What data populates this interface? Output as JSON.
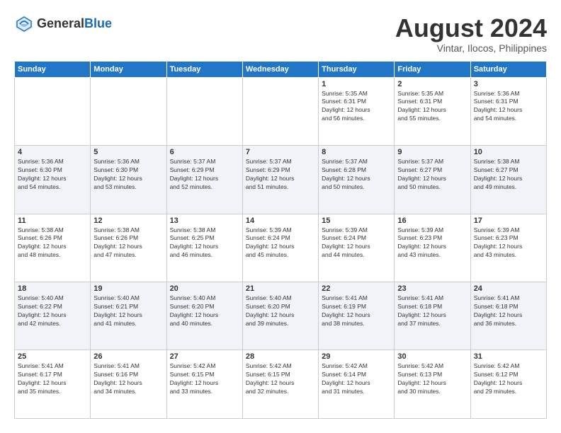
{
  "header": {
    "logo_line1": "General",
    "logo_line2": "Blue",
    "month_year": "August 2024",
    "location": "Vintar, Ilocos, Philippines"
  },
  "days_of_week": [
    "Sunday",
    "Monday",
    "Tuesday",
    "Wednesday",
    "Thursday",
    "Friday",
    "Saturday"
  ],
  "weeks": [
    [
      {
        "day": "",
        "info": ""
      },
      {
        "day": "",
        "info": ""
      },
      {
        "day": "",
        "info": ""
      },
      {
        "day": "",
        "info": ""
      },
      {
        "day": "1",
        "info": "Sunrise: 5:35 AM\nSunset: 6:31 PM\nDaylight: 12 hours\nand 56 minutes."
      },
      {
        "day": "2",
        "info": "Sunrise: 5:35 AM\nSunset: 6:31 PM\nDaylight: 12 hours\nand 55 minutes."
      },
      {
        "day": "3",
        "info": "Sunrise: 5:36 AM\nSunset: 6:31 PM\nDaylight: 12 hours\nand 54 minutes."
      }
    ],
    [
      {
        "day": "4",
        "info": "Sunrise: 5:36 AM\nSunset: 6:30 PM\nDaylight: 12 hours\nand 54 minutes."
      },
      {
        "day": "5",
        "info": "Sunrise: 5:36 AM\nSunset: 6:30 PM\nDaylight: 12 hours\nand 53 minutes."
      },
      {
        "day": "6",
        "info": "Sunrise: 5:37 AM\nSunset: 6:29 PM\nDaylight: 12 hours\nand 52 minutes."
      },
      {
        "day": "7",
        "info": "Sunrise: 5:37 AM\nSunset: 6:29 PM\nDaylight: 12 hours\nand 51 minutes."
      },
      {
        "day": "8",
        "info": "Sunrise: 5:37 AM\nSunset: 6:28 PM\nDaylight: 12 hours\nand 50 minutes."
      },
      {
        "day": "9",
        "info": "Sunrise: 5:37 AM\nSunset: 6:27 PM\nDaylight: 12 hours\nand 50 minutes."
      },
      {
        "day": "10",
        "info": "Sunrise: 5:38 AM\nSunset: 6:27 PM\nDaylight: 12 hours\nand 49 minutes."
      }
    ],
    [
      {
        "day": "11",
        "info": "Sunrise: 5:38 AM\nSunset: 6:26 PM\nDaylight: 12 hours\nand 48 minutes."
      },
      {
        "day": "12",
        "info": "Sunrise: 5:38 AM\nSunset: 6:26 PM\nDaylight: 12 hours\nand 47 minutes."
      },
      {
        "day": "13",
        "info": "Sunrise: 5:38 AM\nSunset: 6:25 PM\nDaylight: 12 hours\nand 46 minutes."
      },
      {
        "day": "14",
        "info": "Sunrise: 5:39 AM\nSunset: 6:24 PM\nDaylight: 12 hours\nand 45 minutes."
      },
      {
        "day": "15",
        "info": "Sunrise: 5:39 AM\nSunset: 6:24 PM\nDaylight: 12 hours\nand 44 minutes."
      },
      {
        "day": "16",
        "info": "Sunrise: 5:39 AM\nSunset: 6:23 PM\nDaylight: 12 hours\nand 43 minutes."
      },
      {
        "day": "17",
        "info": "Sunrise: 5:39 AM\nSunset: 6:23 PM\nDaylight: 12 hours\nand 43 minutes."
      }
    ],
    [
      {
        "day": "18",
        "info": "Sunrise: 5:40 AM\nSunset: 6:22 PM\nDaylight: 12 hours\nand 42 minutes."
      },
      {
        "day": "19",
        "info": "Sunrise: 5:40 AM\nSunset: 6:21 PM\nDaylight: 12 hours\nand 41 minutes."
      },
      {
        "day": "20",
        "info": "Sunrise: 5:40 AM\nSunset: 6:20 PM\nDaylight: 12 hours\nand 40 minutes."
      },
      {
        "day": "21",
        "info": "Sunrise: 5:40 AM\nSunset: 6:20 PM\nDaylight: 12 hours\nand 39 minutes."
      },
      {
        "day": "22",
        "info": "Sunrise: 5:41 AM\nSunset: 6:19 PM\nDaylight: 12 hours\nand 38 minutes."
      },
      {
        "day": "23",
        "info": "Sunrise: 5:41 AM\nSunset: 6:18 PM\nDaylight: 12 hours\nand 37 minutes."
      },
      {
        "day": "24",
        "info": "Sunrise: 5:41 AM\nSunset: 6:18 PM\nDaylight: 12 hours\nand 36 minutes."
      }
    ],
    [
      {
        "day": "25",
        "info": "Sunrise: 5:41 AM\nSunset: 6:17 PM\nDaylight: 12 hours\nand 35 minutes."
      },
      {
        "day": "26",
        "info": "Sunrise: 5:41 AM\nSunset: 6:16 PM\nDaylight: 12 hours\nand 34 minutes."
      },
      {
        "day": "27",
        "info": "Sunrise: 5:42 AM\nSunset: 6:15 PM\nDaylight: 12 hours\nand 33 minutes."
      },
      {
        "day": "28",
        "info": "Sunrise: 5:42 AM\nSunset: 6:15 PM\nDaylight: 12 hours\nand 32 minutes."
      },
      {
        "day": "29",
        "info": "Sunrise: 5:42 AM\nSunset: 6:14 PM\nDaylight: 12 hours\nand 31 minutes."
      },
      {
        "day": "30",
        "info": "Sunrise: 5:42 AM\nSunset: 6:13 PM\nDaylight: 12 hours\nand 30 minutes."
      },
      {
        "day": "31",
        "info": "Sunrise: 5:42 AM\nSunset: 6:12 PM\nDaylight: 12 hours\nand 29 minutes."
      }
    ]
  ]
}
